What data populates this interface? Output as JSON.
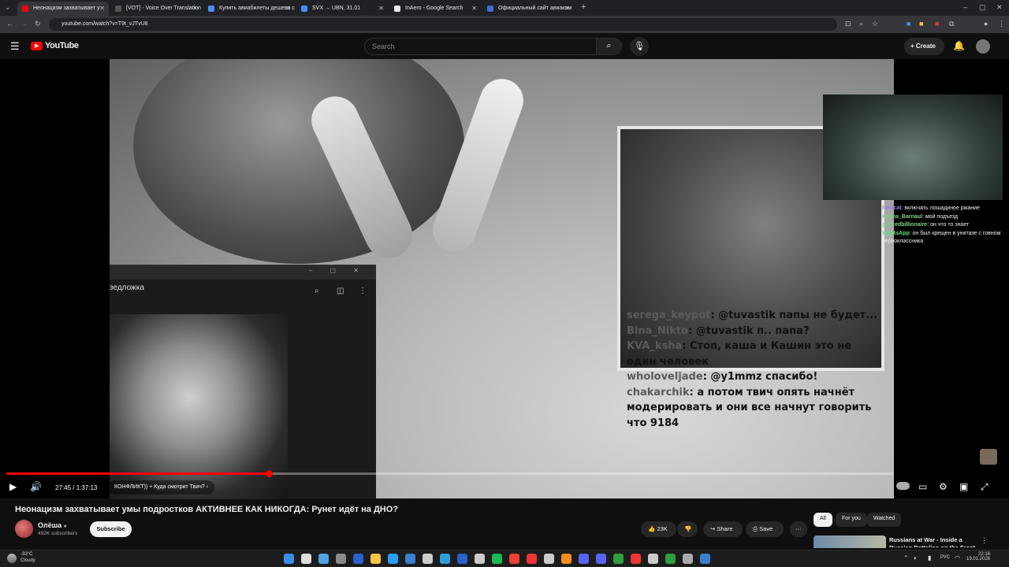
{
  "browser": {
    "tabs": [
      {
        "label": "Неонацизм захватывает у",
        "active": true,
        "fav_color": "#ff0000"
      },
      {
        "label": "[VOT] - Voice Over Translation",
        "active": false,
        "fav_color": "#555555"
      },
      {
        "label": "Купить авиабилеты дешево с",
        "active": false,
        "fav_color": "#4a8df8"
      },
      {
        "label": "SVX → UBN, 31.01",
        "active": false,
        "fav_color": "#4a8df8"
      },
      {
        "label": "InAero - Google Search",
        "active": false,
        "fav_color": "#e8eaed"
      },
      {
        "label": "Официальный сайт авиаком",
        "active": false,
        "fav_color": "#3b6fd6"
      }
    ],
    "url": "youtube.com/watch?v=T9t_vJTvU8"
  },
  "yt": {
    "logo": "YouTube",
    "search_placeholder": "Search",
    "create_label": "Create"
  },
  "video": {
    "overlay_window_label": "зедложка",
    "twitch_chat": [
      {
        "name": "himicat",
        "text": ": включать лошадиное ржание",
        "color": "#9b7fd9"
      },
      {
        "name": "Kesha_Barnaul",
        "text": ": мой подъезд",
        "color": "#7fd17f"
      },
      {
        "name": "geekedbillionaire",
        "text": ": он что то знает",
        "color": "#7fd17f"
      },
      {
        "name": "WhatsApp",
        "text": ": он был крещен в унитазе с говном первоклассника",
        "color": "#5fe07f"
      }
    ],
    "stream_chat": [
      {
        "name": "serega_keypot",
        "text": ": @tuvastik папы не будет..."
      },
      {
        "name": "Bina_Nikto",
        "text": ": @tuvastik п.. папа?"
      },
      {
        "name": "KVA_ksha",
        "text": ": Стоп, каша и Кашин это не один человек"
      },
      {
        "name": "wholoveljade",
        "text": ": @y1mmz спасибо!"
      },
      {
        "name": "chakarchik",
        "text": ": а потом твич опять начнёт модерировать и они все начнут говорить что 9184"
      }
    ]
  },
  "player": {
    "progress": 0.296,
    "time": "27:45 / 1:37:13",
    "chapter": "КОНФЛИКТ)) + Куда смотрит Твич?"
  },
  "meta": {
    "title": "Неонацизм захватывает умы подростков АКТИВНЕЕ КАК НИКОГДА: Рунет идёт на ДНО?",
    "channel": "Олёша",
    "subscribers": "492K subscribers",
    "subscribe_label": "Subscribe",
    "likes": "23K",
    "share_label": "Share",
    "save_label": "Save"
  },
  "sidebar": {
    "chips": [
      {
        "label": "All",
        "active": true
      },
      {
        "label": "For you",
        "active": false
      },
      {
        "label": "Watched",
        "active": false
      }
    ],
    "rec_title": "Russians at War - Inside a Russian Battalion on the Front"
  },
  "taskbar": {
    "temp": "-33°C",
    "weather": "Cloudy",
    "lang": "РУС",
    "time": "22:16",
    "date": "19.01.2026"
  }
}
